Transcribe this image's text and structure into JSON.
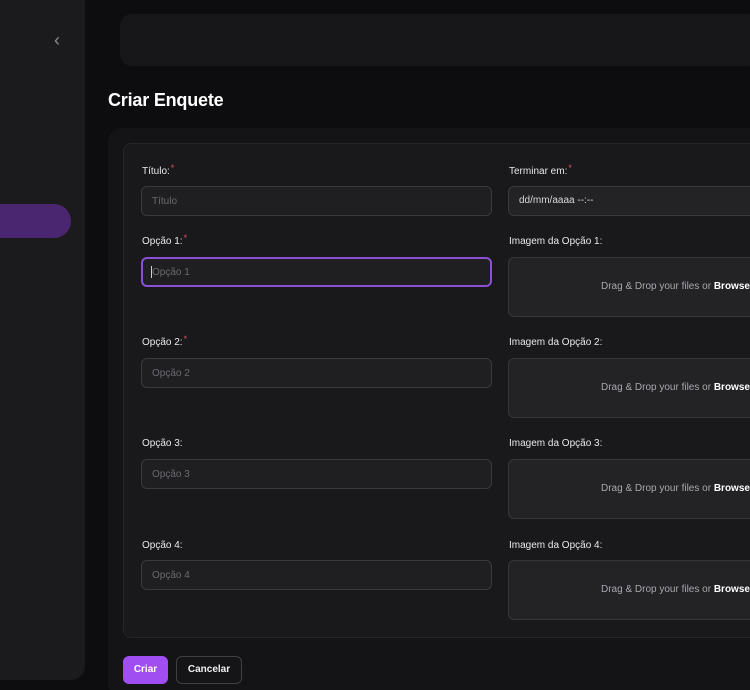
{
  "sidebar": {
    "collapse_icon": "chevron-left-icon"
  },
  "page": {
    "title": "Criar Enquete"
  },
  "form": {
    "title_label": "Título:",
    "title_placeholder": "Título",
    "end_label": "Terminar em:",
    "end_value": "dd/mm/aaaa --:--",
    "required_mark": "*",
    "options": [
      {
        "label": "Opção 1:",
        "placeholder": "Opção 1",
        "required": true,
        "image_label": "Imagem da Opção 1:"
      },
      {
        "label": "Opção 2:",
        "placeholder": "Opção 2",
        "required": true,
        "image_label": "Imagem da Opção 2:"
      },
      {
        "label": "Opção 3:",
        "placeholder": "Opção 3",
        "required": false,
        "image_label": "Imagem da Opção 3:"
      },
      {
        "label": "Opção 4:",
        "placeholder": "Opção 4",
        "required": false,
        "image_label": "Imagem da Opção 4:"
      }
    ],
    "dropzone_text": "Drag & Drop your files or ",
    "dropzone_browse": "Browse"
  },
  "actions": {
    "submit_label": "Criar",
    "cancel_label": "Cancelar"
  },
  "colors": {
    "accent": "#a04ef2",
    "focus_border": "#8b4fd8",
    "sidebar_active": "#4a2670",
    "required": "#e0506a"
  }
}
